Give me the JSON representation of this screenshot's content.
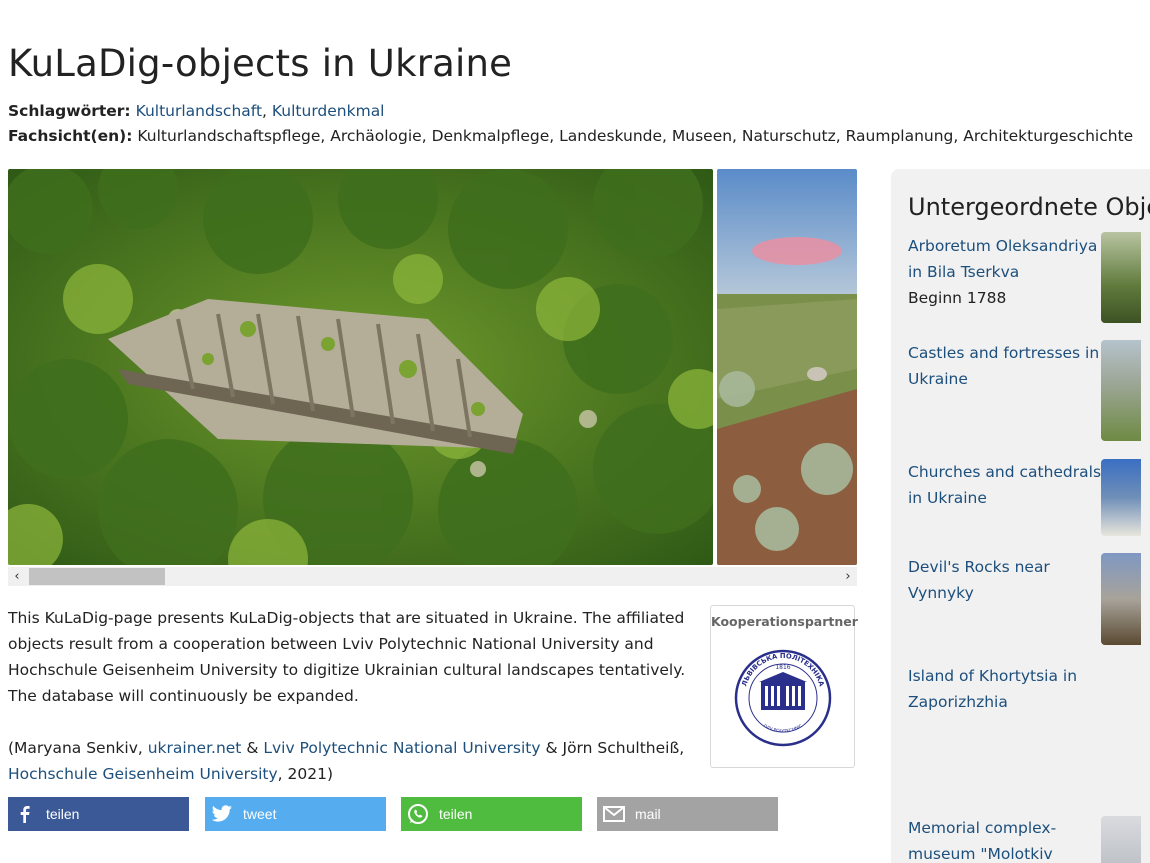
{
  "page": {
    "title": "KuLaDig-objects in Ukraine",
    "keywords_label": "Schlagwörter:",
    "keywords": [
      "Kulturlandschaft",
      "Kulturdenkmal"
    ],
    "keywords_sep": ", ",
    "views_label": "Fachsicht(en):",
    "views_value": "Kulturlandschaftspflege, Archäologie, Denkmalpflege, Landeskunde, Museen, Naturschutz, Raumplanung, Architekturgeschichte"
  },
  "gallery": {
    "scroll_left_glyph": "‹",
    "scroll_right_glyph": "›"
  },
  "description": {
    "text": "This KuLaDig-page presents KuLaDig-objects that are situated in Ukraine. The affiliated objects result from a cooperation between Lviv Polytechnic National University and Hochschule Geisenheim University to digitize Ukrainian cultural landscapes tentatively. The database will continuously be expanded.",
    "credit_open": "(Maryana Senkiv, ",
    "link1": "ukrainer.net",
    "amp1": " & ",
    "link2": "Lviv Polytechnic National University",
    "mid": " & Jörn Schultheiß, ",
    "link3": "Hochschule Geisenheim University",
    "credit_close": ", 2021)"
  },
  "partner": {
    "label": "Kooperationspartner",
    "logo_text_top": "НАЦІОНАЛЬНИЙ УНІВЕРСИТЕТ",
    "logo_text_main": "ЛЬВІВСЬКА ПОЛІТЕХНІКА",
    "logo_year": "1816",
    "logo_text_bottom": "LVIV POLYTECHNIC"
  },
  "share": {
    "facebook": "teilen",
    "twitter": "tweet",
    "whatsapp": "teilen",
    "mail": "mail"
  },
  "sidebar": {
    "title": "Untergeordnete Objekte",
    "items": [
      {
        "name": "Arboretum Oleksandriya in Bila Tserkva",
        "sub": "Beginn 1788"
      },
      {
        "name": "Castles and fortresses in Ukraine",
        "sub": ""
      },
      {
        "name": "Churches and cathedrals in Ukraine",
        "sub": ""
      },
      {
        "name": "Devil's Rocks near Vynnyky",
        "sub": ""
      },
      {
        "name": "Island of Khortytsia in Zaporizhzhia",
        "sub": ""
      },
      {
        "name": "Memorial complex-museum \"Molotkiv",
        "sub": ""
      }
    ]
  },
  "colors": {
    "link": "#1d4f7c",
    "facebook": "#3b5997",
    "twitter": "#55acee",
    "whatsapp": "#4fbb3f",
    "mail": "#a3a3a3",
    "sidebar_bg": "#f1f1f1"
  }
}
